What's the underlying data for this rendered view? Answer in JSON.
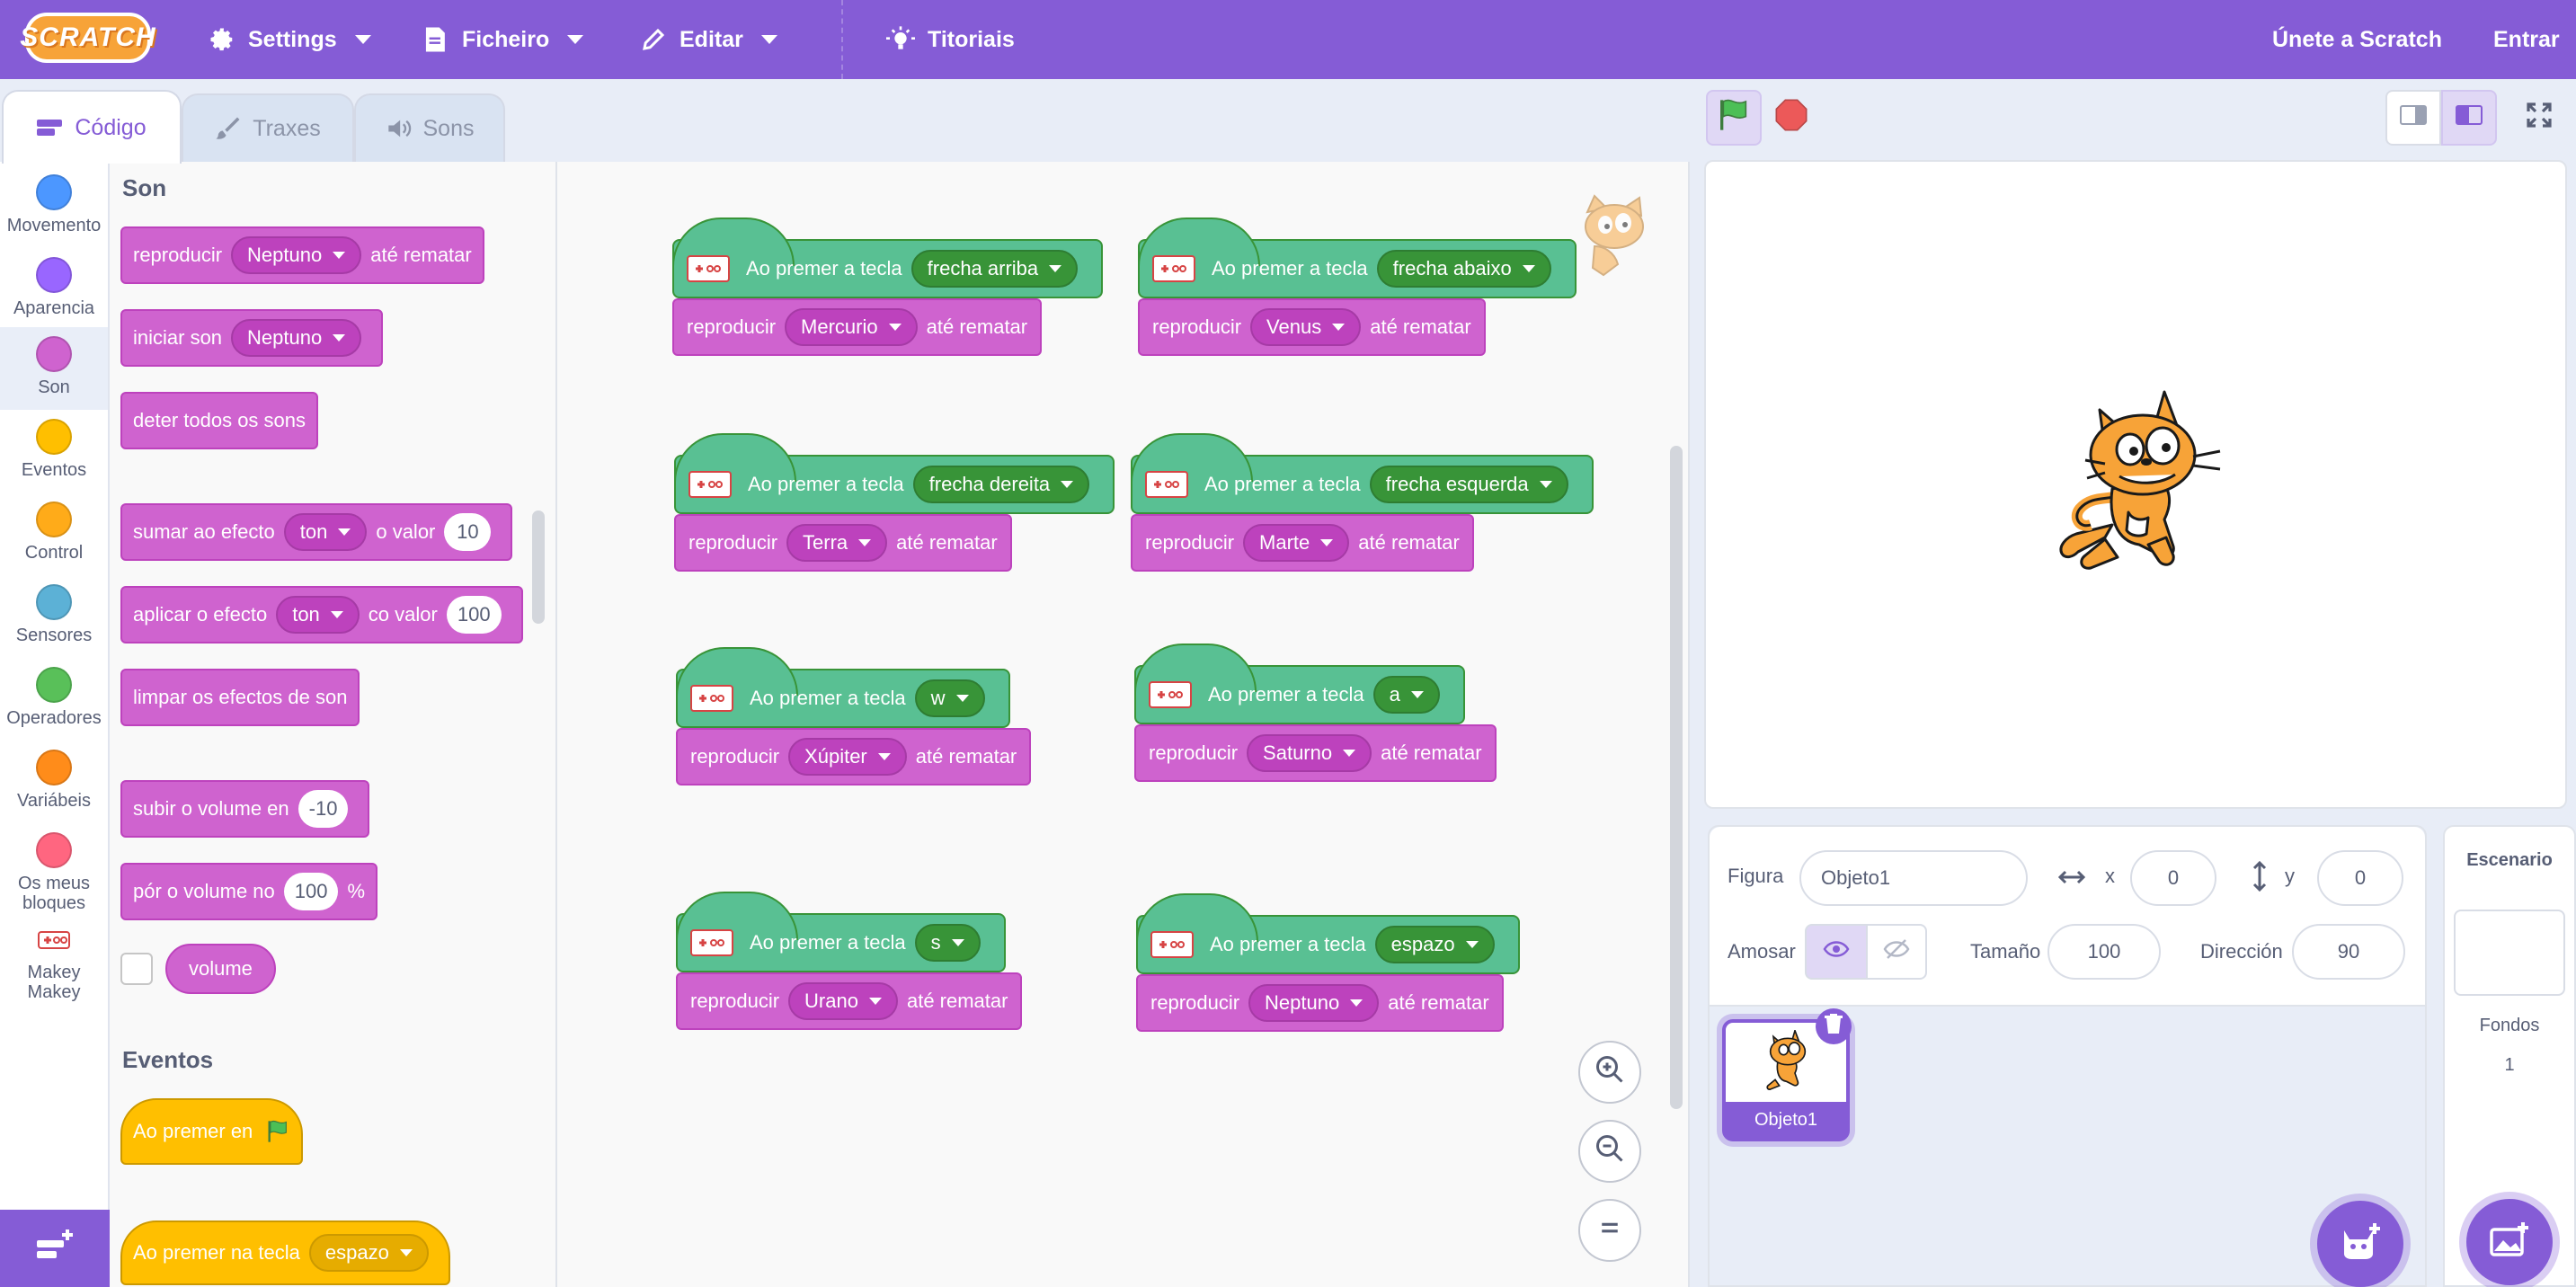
{
  "menubar": {
    "logo": "SCRATCH",
    "settings": "Settings",
    "file": "Ficheiro",
    "edit": "Editar",
    "tutorials": "Titoriais",
    "join": "Únete a Scratch",
    "signin": "Entrar"
  },
  "tabs": {
    "code": "Código",
    "costumes": "Traxes",
    "sounds": "Sons"
  },
  "categories": [
    "Movemento",
    "Aparencia",
    "Son",
    "Eventos",
    "Control",
    "Sensores",
    "Operadores",
    "Variábeis",
    "Os meus bloques",
    "Makey Makey"
  ],
  "colors": {
    "accent": "#855cd6",
    "sound": "#cf63cf",
    "events": "#ffbf00",
    "makey": "#59c093"
  },
  "palette": {
    "sound_header": "Son",
    "play_until_done": {
      "t1": "reproducir",
      "dd": "Neptuno",
      "t2": "até rematar"
    },
    "start_sound": {
      "t1": "iniciar son",
      "dd": "Neptuno"
    },
    "stop_all": "deter todos os sons",
    "change_effect": {
      "t1": "sumar ao efecto",
      "dd": "ton",
      "t2": "o valor",
      "v": "10"
    },
    "set_effect": {
      "t1": "aplicar o efecto",
      "dd": "ton",
      "t2": "co valor",
      "v": "100"
    },
    "clear_effects": "limpar os efectos de son",
    "change_volume": {
      "t1": "subir o volume en",
      "v": "-10"
    },
    "set_volume": {
      "t1": "pór o volume no",
      "v": "100",
      "t2": "%"
    },
    "volume_reporter": "volume",
    "events_header": "Eventos",
    "when_flag": "Ao premer en",
    "when_key": {
      "t1": "Ao premer na tecla",
      "dd": "espazo"
    }
  },
  "scripts": [
    {
      "hat": "Ao premer a tecla",
      "key": "frecha arriba",
      "play": "reproducir",
      "sound": "Mercurio",
      "until": "até rematar"
    },
    {
      "hat": "Ao premer a tecla",
      "key": "frecha abaixo",
      "play": "reproducir",
      "sound": "Venus",
      "until": "até rematar"
    },
    {
      "hat": "Ao premer a tecla",
      "key": "frecha dereita",
      "play": "reproducir",
      "sound": "Terra",
      "until": "até rematar"
    },
    {
      "hat": "Ao premer a tecla",
      "key": "frecha esquerda",
      "play": "reproducir",
      "sound": "Marte",
      "until": "até rematar"
    },
    {
      "hat": "Ao premer a tecla",
      "key": "w",
      "play": "reproducir",
      "sound": "Xúpiter",
      "until": "até rematar"
    },
    {
      "hat": "Ao premer a tecla",
      "key": "a",
      "play": "reproducir",
      "sound": "Saturno",
      "until": "até rematar"
    },
    {
      "hat": "Ao premer a tecla",
      "key": "s",
      "play": "reproducir",
      "sound": "Urano",
      "until": "até rematar"
    },
    {
      "hat": "Ao premer a tecla",
      "key": "espazo",
      "play": "reproducir",
      "sound": "Neptuno",
      "until": "até rematar"
    }
  ],
  "sprite": {
    "label": "Figura",
    "name": "Objeto1",
    "x_label": "x",
    "x": "0",
    "y_label": "y",
    "y": "0",
    "show_label": "Amosar",
    "size_label": "Tamaño",
    "size": "100",
    "direction_label": "Dirección",
    "direction": "90",
    "thumb_name": "Objeto1"
  },
  "stage_panel": {
    "title": "Escenario",
    "backdrops_label": "Fondos",
    "backdrops_count": "1"
  }
}
